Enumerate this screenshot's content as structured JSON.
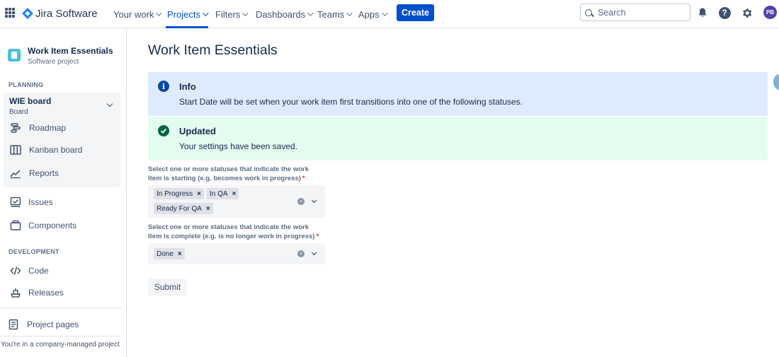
{
  "topnav": {
    "logo_text": "Jira Software",
    "items": [
      {
        "label": "Your work"
      },
      {
        "label": "Projects"
      },
      {
        "label": "Filters"
      },
      {
        "label": "Dashboards"
      },
      {
        "label": "Teams"
      },
      {
        "label": "Apps"
      }
    ],
    "create_label": "Create",
    "search_placeholder": "Search",
    "avatar_initials": "PB"
  },
  "sidebar": {
    "project_name": "Work Item Essentials",
    "project_type": "Software project",
    "planning_label": "PLANNING",
    "board_title": "WIE board",
    "board_sub": "Board",
    "planning_items": [
      {
        "label": "Roadmap",
        "icon": "roadmap-icon"
      },
      {
        "label": "Kanban board",
        "icon": "kanban-board-icon"
      },
      {
        "label": "Reports",
        "icon": "reports-icon"
      }
    ],
    "other_items": [
      {
        "label": "Issues",
        "icon": "issues-icon"
      },
      {
        "label": "Components",
        "icon": "components-icon"
      }
    ],
    "development_label": "DEVELOPMENT",
    "development_items": [
      {
        "label": "Code",
        "icon": "code-icon"
      },
      {
        "label": "Releases",
        "icon": "releases-icon"
      }
    ],
    "project_pages": "Project pages",
    "managed_note": "You're in a company-managed project"
  },
  "main": {
    "title": "Work Item Essentials",
    "info": {
      "title": "Info",
      "text": "Start Date will be set when your work item first transitions into one of the following statuses."
    },
    "success": {
      "title": "Updated",
      "text": "Your settings have been saved."
    },
    "start_field": {
      "label_line1": "Select one or more statuses that indicate the work",
      "label_line2": "item is starting (e.g. becomes work in progress)",
      "required_mark": "*",
      "chips": [
        "In Progress",
        "In QA",
        "Ready For QA"
      ]
    },
    "complete_field": {
      "label_line1": "Select one or more statuses that indicate the work",
      "label_line2": "item is complete (e.g. is no longer work in progress)",
      "required_mark": "*",
      "chips": [
        "Done"
      ]
    },
    "chip_remove": "×",
    "clear_glyph": "×",
    "submit_label": "Submit"
  },
  "colors": {
    "brand": "#0052cc",
    "info_bg": "#deebff",
    "success_bg": "#e3fcef",
    "required": "#de350b"
  }
}
